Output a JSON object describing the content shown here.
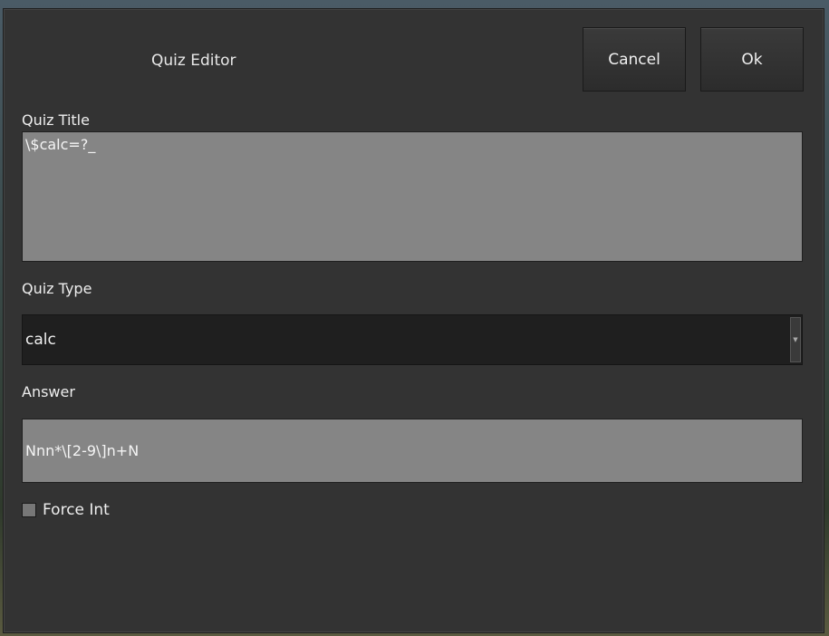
{
  "dialog": {
    "title": "Quiz Editor",
    "cancel_label": "Cancel",
    "ok_label": "Ok"
  },
  "quiz_title": {
    "label": "Quiz Title",
    "value": "\\$calc=?_"
  },
  "quiz_type": {
    "label": "Quiz Type",
    "selected": "calc",
    "arrow_icon": "chevron-down-icon"
  },
  "answer": {
    "label": "Answer",
    "value": "Nnn*\\[2-9\\]n+N"
  },
  "force_int": {
    "label": "Force Int",
    "checked": false
  }
}
